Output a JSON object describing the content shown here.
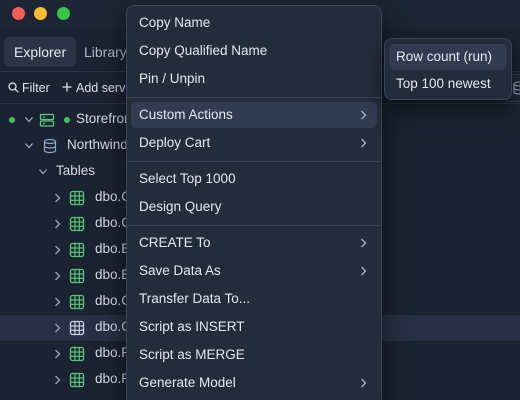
{
  "window": {
    "traffic_lights": {
      "close": "#f25f58",
      "minimize": "#f9be2f",
      "zoom": "#39c548"
    }
  },
  "tabs": [
    {
      "label": "Explorer",
      "active": true
    },
    {
      "label": "Library",
      "active": false
    }
  ],
  "toolbar": {
    "filter_label": "Filter",
    "add_server_label": "Add serve"
  },
  "tree": {
    "server": {
      "label": "Storefron",
      "status": "connected",
      "status_color": "#3fc34e"
    },
    "database": {
      "label": "Northwind"
    },
    "tables_folder": {
      "label": "Tables"
    },
    "tables": [
      {
        "label": "dbo.C"
      },
      {
        "label": "dbo.C"
      },
      {
        "label": "dbo.E"
      },
      {
        "label": "dbo.E"
      },
      {
        "label": "dbo.C"
      },
      {
        "label": "dbo.C",
        "selected": true
      },
      {
        "label": "dbo.R"
      },
      {
        "label": "dbo.R"
      }
    ]
  },
  "context_menu": {
    "items": [
      {
        "label": "Copy Name"
      },
      {
        "label": "Copy Qualified Name"
      },
      {
        "label": "Pin / Unpin"
      },
      {
        "label": "Custom Actions",
        "submenu": true,
        "highlighted": true
      },
      {
        "label": "Deploy Cart",
        "submenu": true
      },
      {
        "label": "Select Top 1000"
      },
      {
        "label": "Design Query"
      },
      {
        "label": "CREATE To",
        "submenu": true
      },
      {
        "label": "Save Data As",
        "submenu": true
      },
      {
        "label": "Transfer Data To..."
      },
      {
        "label": "Script as INSERT"
      },
      {
        "label": "Script as MERGE"
      },
      {
        "label": "Generate Model",
        "submenu": true
      }
    ]
  },
  "submenu": {
    "items": [
      {
        "label": "Row count (run)",
        "highlighted": true
      },
      {
        "label": "Top 100 newest"
      }
    ]
  },
  "colors": {
    "background": "#1b2231",
    "menu_background": "#242c3c",
    "menu_highlight": "#323c50",
    "accent_green": "#3fc34e",
    "table_icon": "#57c97a"
  }
}
